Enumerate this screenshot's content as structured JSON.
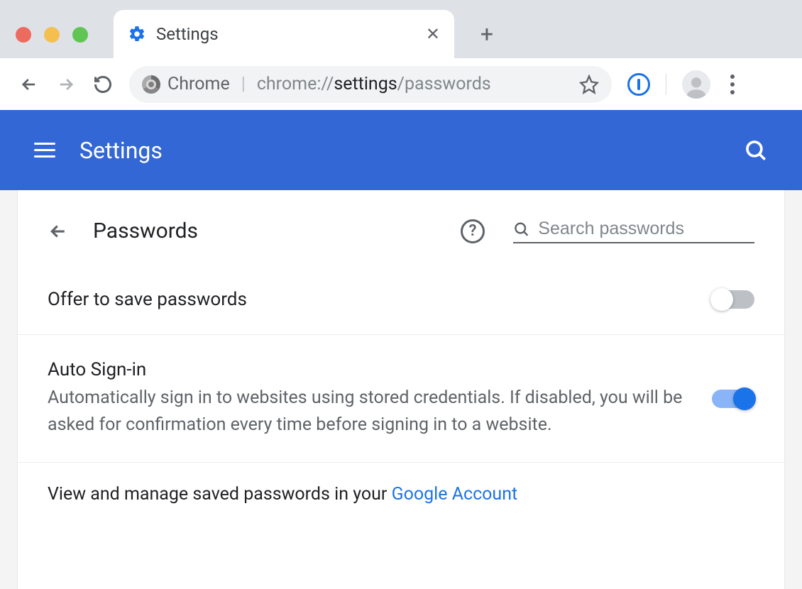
{
  "window": {
    "tab_title": "Settings"
  },
  "omnibox": {
    "chip": "Chrome",
    "url_prefix": "chrome://",
    "url_strong": "settings",
    "url_suffix": "/passwords"
  },
  "header": {
    "title": "Settings"
  },
  "page": {
    "title": "Passwords",
    "search_placeholder": "Search passwords"
  },
  "rows": {
    "offer_save": {
      "title": "Offer to save passwords"
    },
    "auto_signin": {
      "title": "Auto Sign-in",
      "desc": "Automatically sign in to websites using stored credentials. If disabled, you will be asked for confirmation every time before signing in to a website."
    },
    "manage": {
      "text": "View and manage saved passwords in your ",
      "link": "Google Account"
    }
  }
}
